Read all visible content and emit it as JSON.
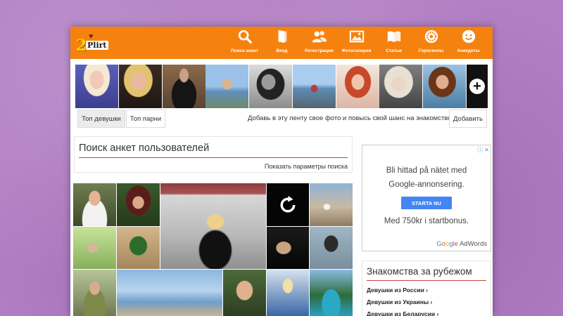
{
  "logo": {
    "number": "2",
    "word": "Plirt"
  },
  "nav": [
    {
      "id": "search",
      "label": "Поиск анкет",
      "icon": "search-icon"
    },
    {
      "id": "login",
      "label": "Вход",
      "icon": "door-icon"
    },
    {
      "id": "register",
      "label": "Регистрация",
      "icon": "users-icon"
    },
    {
      "id": "gallery",
      "label": "Фотогалерея",
      "icon": "picture-icon"
    },
    {
      "id": "articles",
      "label": "Статьи",
      "icon": "book-icon"
    },
    {
      "id": "horoscopes",
      "label": "Гороскопы",
      "icon": "zodiac-icon"
    },
    {
      "id": "jokes",
      "label": "Анекдоты",
      "icon": "smiley-icon"
    }
  ],
  "strip": {
    "add_symbol": "+"
  },
  "tabs": {
    "top_girls": "Топ девушки",
    "top_boys": "Топ парни",
    "promo_text": "Добавь в эту ленту свое фото и повысь свой шанс на знакомство!",
    "add_button": "Добавить"
  },
  "search": {
    "title": "Поиск анкет пользователей",
    "show_params": "Показать параметры поиска"
  },
  "ad": {
    "line1": "Bli hittad på nätet med",
    "line2": "Google-annonsering.",
    "button": "STARTA NU",
    "line3": "Med 750kr i startbonus.",
    "brand_adwords": "AdWords"
  },
  "abroad": {
    "title": "Знакомства за рубежом",
    "links": [
      "Девушки из России ›",
      "Девушки из Украины ›",
      "Девушки из Беларусии ›"
    ]
  },
  "colors": {
    "brand_orange": "#f5820f",
    "accent_red": "#c9463c",
    "ad_blue": "#4285f4",
    "desktop_purple": "#b27fc4"
  }
}
